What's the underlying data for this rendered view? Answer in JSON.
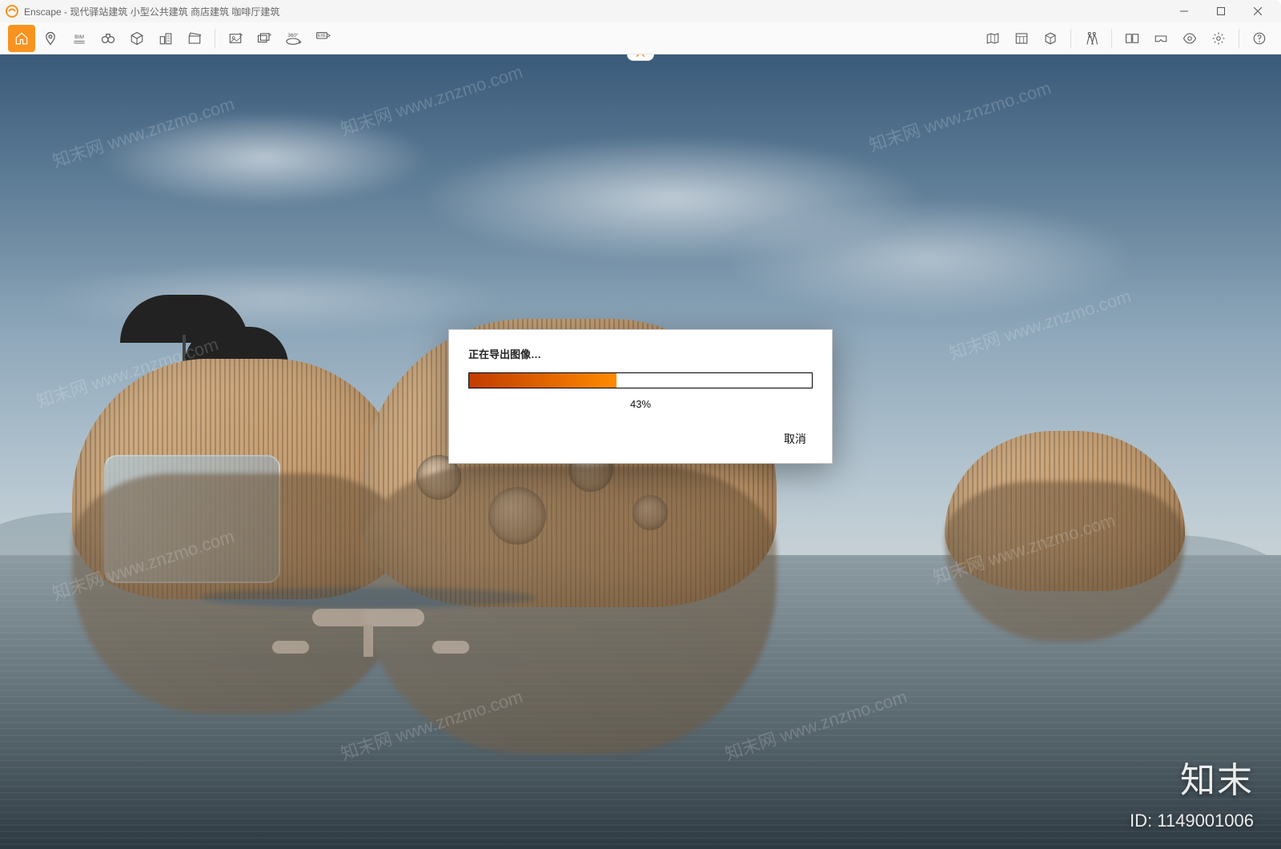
{
  "window": {
    "app_name": "Enscape",
    "title_sep": " - ",
    "document_title": "现代驿站建筑 小型公共建筑 商店建筑 咖啡厅建筑"
  },
  "toolbar_left": [
    {
      "id": "home",
      "name": "home-icon",
      "active": true
    },
    {
      "id": "pin",
      "name": "map-pin-icon"
    },
    {
      "id": "bim",
      "name": "bim-icon",
      "label": "BIM"
    },
    {
      "id": "binoc",
      "name": "binoculars-icon"
    },
    {
      "id": "cube",
      "name": "3d-cube-icon"
    },
    {
      "id": "city",
      "name": "buildings-icon"
    },
    {
      "id": "clap",
      "name": "clapperboard-icon"
    },
    {
      "id": "sep1",
      "sep": true
    },
    {
      "id": "export-image",
      "name": "export-image-icon"
    },
    {
      "id": "export-batch",
      "name": "export-batch-icon"
    },
    {
      "id": "export-360",
      "name": "export-360-icon",
      "label": "360°"
    },
    {
      "id": "export-exe",
      "name": "export-exe-icon",
      "label": "EXE"
    }
  ],
  "toolbar_right": [
    {
      "id": "map",
      "name": "minimap-icon"
    },
    {
      "id": "assets",
      "name": "asset-library-icon"
    },
    {
      "id": "pano",
      "name": "panorama-cube-icon"
    },
    {
      "id": "sep2",
      "sep": true
    },
    {
      "id": "walk",
      "name": "walk-mode-icon"
    },
    {
      "id": "sep3",
      "sep": true
    },
    {
      "id": "sync",
      "name": "sync-views-icon"
    },
    {
      "id": "vr",
      "name": "vr-headset-icon"
    },
    {
      "id": "eye",
      "name": "visual-settings-icon"
    },
    {
      "id": "gear",
      "name": "settings-gear-icon"
    },
    {
      "id": "sep4",
      "sep": true
    },
    {
      "id": "help",
      "name": "help-icon"
    }
  ],
  "modal": {
    "title": "正在导出图像…",
    "percent_value": 43,
    "percent_label": "43%",
    "cancel_label": "取消"
  },
  "watermark": {
    "brand_text": "知末",
    "id_prefix": "ID: ",
    "id_value": "1149001006",
    "repeat_text": "知末网 www.znzmo.com"
  },
  "colors": {
    "accent": "#f7931e",
    "progress_start": "#c23c00",
    "progress_end": "#ff8a00"
  }
}
